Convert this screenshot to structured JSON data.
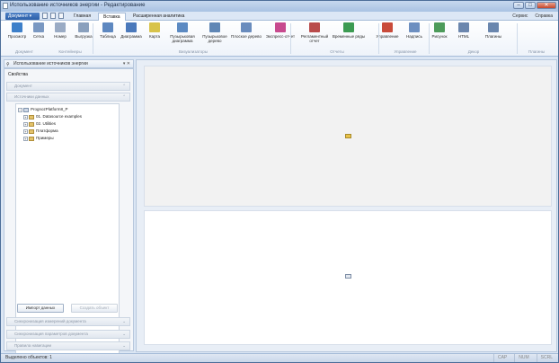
{
  "window": {
    "title": "Использование источников энергии - Редактирование",
    "controls": [
      "–",
      "□",
      "✕"
    ]
  },
  "tabrow": {
    "document_button": "Документ",
    "tabs": [
      "Главная",
      "Вставка",
      "Расширенная аналитика"
    ],
    "active_tab": "Вставка",
    "right_links": [
      "Сервис",
      "Справка"
    ]
  },
  "ribbon": {
    "buttons": [
      {
        "label": "Просмотр",
        "icon": "preview-icon",
        "color": "#3d7fc9"
      },
      {
        "label": "Сетка",
        "icon": "grid-icon",
        "color": "#7a98c2"
      },
      {
        "label": "Номер",
        "icon": "number-icon",
        "color": "#9aabc4"
      },
      {
        "label": "Выгрузка",
        "icon": "export-icon",
        "color": "#8aa0bd"
      },
      {
        "label": "Таблица",
        "icon": "table-icon",
        "color": "#5e88c0"
      },
      {
        "label": "Диаграмма",
        "icon": "chart-icon",
        "color": "#4b79bb"
      },
      {
        "label": "Карта",
        "icon": "map-icon",
        "color": "#d8c34a"
      },
      {
        "label": "Пузырьковая диаграмма",
        "icon": "bubble-chart-icon",
        "color": "#5c8ac2"
      },
      {
        "label": "Пузырьковое дерево",
        "icon": "bubble-tree-icon",
        "color": "#5f86b5"
      },
      {
        "label": "Плоское дерево",
        "icon": "flat-tree-icon",
        "color": "#6a8cbd"
      },
      {
        "label": "Экспресс-отчет",
        "icon": "express-report-icon",
        "color": "#c84a8e"
      },
      {
        "label": "Регламентный отчет",
        "icon": "regulatory-report-icon",
        "color": "#b94b4b"
      },
      {
        "label": "Временные ряды",
        "icon": "time-series-icon",
        "color": "#3c9b52"
      },
      {
        "label": "Управление",
        "icon": "control-icon",
        "color": "#c94b3a"
      },
      {
        "label": "Надпись",
        "icon": "text-label-icon",
        "color": "#6d8fc0"
      },
      {
        "label": "Рисунок",
        "icon": "picture-icon",
        "color": "#4d9b5a"
      },
      {
        "label": "HTML",
        "icon": "html-icon",
        "color": "#6b86ad"
      },
      {
        "label": "Плагины",
        "icon": "plugins-icon",
        "color": "#6a86ad"
      }
    ],
    "groups": [
      "Документ",
      "Контейнеры",
      "Визуализаторы",
      "Отчеты",
      "Управление",
      "Декор",
      "Плагины"
    ]
  },
  "left_panel": {
    "header": "Использование источников энергии",
    "section_title": "Свойства",
    "accordion_top": [
      "Документ",
      "Источники данных"
    ],
    "tree": {
      "root": "PrognozPlatform8_Р",
      "children": [
        "01. Datasource examples",
        "02. Utilities",
        "Платформа",
        "Примеры"
      ]
    },
    "buttons": {
      "import": "Импорт данных",
      "create": "Создать объект"
    },
    "accordion_bottom": [
      "Синхронизация измерений документа",
      "Синхронизация параметров документа",
      "Правила навигации"
    ]
  },
  "status": {
    "left": "Выделено объектов: 1",
    "right": [
      "CAP",
      "NUM",
      "SCRL"
    ]
  }
}
